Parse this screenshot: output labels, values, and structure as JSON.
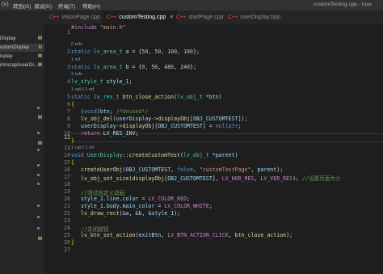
{
  "menubar": {
    "items": [
      "(V)",
      "转到(G)",
      "调试(D)",
      "终端(T)",
      "帮助(H)"
    ],
    "window_title": "customTesting.cpp - tuxe"
  },
  "sidebar": {
    "items": [
      {
        "name": "Display",
        "status": "M"
      },
      {
        "name": "ustomDisplay",
        "status": "U"
      },
      {
        "name": "isplay",
        "status": "M"
      },
      {
        "name": "in\\ncrapi\\userDi...",
        "status": "M"
      },
      {
        "name": "",
        "status": ""
      },
      {
        "name": "",
        "status": "M"
      },
      {
        "name": "",
        "status": "M"
      },
      {
        "name": "",
        "status": "M"
      }
    ]
  },
  "tabs": [
    {
      "label": "visionPage.cpp",
      "icon": "C++",
      "active": false
    },
    {
      "label": "customTesting.cpp",
      "icon": "C++",
      "active": true,
      "close": "×"
    },
    {
      "label": "startPage.cpp",
      "icon": "C++",
      "active": false
    },
    {
      "label": "userDisplay.hpp",
      "icon": "C++",
      "active": false
    }
  ],
  "editor": {
    "current_line": 12,
    "line_numbers": [
      "1",
      "2",
      "3",
      "4",
      "5",
      "6",
      "7",
      "8",
      "9",
      "10",
      "11",
      "12",
      "13",
      "14",
      "15",
      "16",
      "17",
      "18",
      "19",
      "20",
      "21",
      "22",
      "23",
      "24",
      "25",
      "26",
      "27"
    ],
    "codelens": [
      "0 refs",
      "1 ref",
      "3 refs",
      "1 call | 1 ref",
      "1 ref",
      "1 call | 1 ref"
    ],
    "code": {
      "l1": [
        "#include ",
        "\"main.h\""
      ],
      "l2": [
        "static ",
        "lv_area_t ",
        "a",
        " = {",
        "50",
        ", ",
        "50",
        ", ",
        "100",
        ", ",
        "100",
        "};"
      ],
      "l3": [
        "static ",
        "lv_area_t ",
        "b",
        " = {",
        "0",
        ", ",
        "50",
        ", ",
        "480",
        ", ",
        "240",
        "};"
      ],
      "l4": [
        "lv_style_t ",
        "style_1",
        ";"
      ],
      "l5": [
        "static ",
        "lv_res_t ",
        "btn_close_action",
        "(",
        "lv_obj_t ",
        "*btn",
        ")"
      ],
      "l6": [
        "{"
      ],
      "l7": [
        "(",
        "void",
        ")",
        "btn",
        "; ",
        "/*Unused*/"
      ],
      "l8": [
        "lv_obj_del",
        "(",
        "userDisplay",
        "->",
        "displayObj",
        "[",
        "OBJ_CUSTOMTEST",
        "]);"
      ],
      "l9": [
        "userDisplay",
        "->",
        "displayObj",
        "[",
        "OBJ_CUSTOMTEST",
        "] = ",
        "nullptr",
        ";"
      ],
      "l10": [
        "return ",
        "LV_RES_INV",
        ";"
      ],
      "l11": [
        "}"
      ],
      "l12": [
        ""
      ],
      "l13": [
        "void ",
        "UserDisplay",
        "::",
        "createCustomTest",
        "(",
        "lv_obj_t ",
        "*parent",
        ")"
      ],
      "l14": [
        "{"
      ],
      "l15": [
        "createUserObj",
        "(",
        "OBJ_CUSTOMTEST",
        ", ",
        "false",
        ", ",
        "\"customTestPage\"",
        ", ",
        "parent",
        ");"
      ],
      "l16": [
        "lv_obj_set_size",
        "(",
        "displayObj",
        "[",
        "OBJ_CUSTOMTEST",
        "], ",
        "LV_HOR_RES",
        ", ",
        "LV_VER_RES",
        "); ",
        "//设置页面大小"
      ],
      "l17": [
        ""
      ],
      "l18": [
        "//测试自定义动画"
      ],
      "l19": [
        "style_1",
        ".",
        "line",
        ".",
        "color",
        " = ",
        "LV_COLOR_RED",
        ";"
      ],
      "l20": [
        "style_1",
        ".",
        "body",
        ".",
        "main_color",
        " = ",
        "LV_COLOR_WHITE",
        ";"
      ],
      "l21": [
        "lv_draw_rect",
        "(",
        "&a",
        ", ",
        "&b",
        ", ",
        "&style_1",
        ");"
      ],
      "l22": [
        ""
      ],
      "l23": [
        "//关闭按钮"
      ],
      "l24": [
        "lv_btn_set_action",
        "(",
        "exitBtn",
        ", ",
        "LV_BTN_ACTION_CLICK",
        ", ",
        "btn_close_action",
        ");"
      ],
      "l25": [
        "}"
      ]
    }
  },
  "colors": {
    "keyword": "#569cd6",
    "string": "#ce9178",
    "type": "#4ec9b0",
    "function": "#dcdcaa",
    "variable": "#9cdcfe",
    "number": "#b5cea8",
    "comment": "#6a9955",
    "macro": "#c586c0"
  }
}
